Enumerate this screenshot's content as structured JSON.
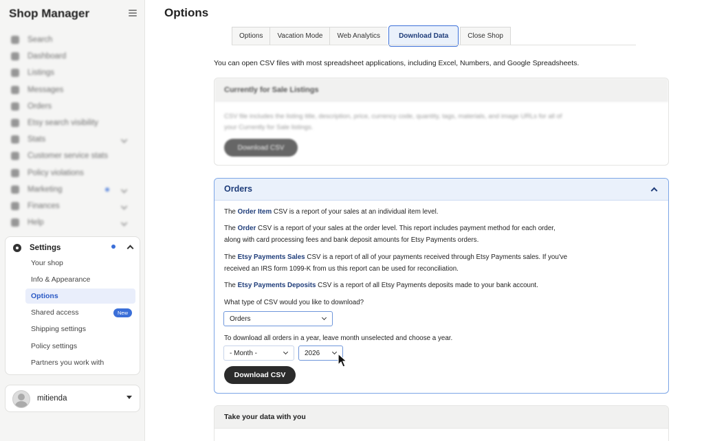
{
  "sidebar": {
    "brand": "Shop Manager",
    "nav": [
      {
        "label": "Search",
        "icon": "search-icon"
      },
      {
        "label": "Dashboard",
        "icon": "home-icon"
      },
      {
        "label": "Listings",
        "icon": "tag-icon"
      },
      {
        "label": "Messages",
        "icon": "chat-icon"
      },
      {
        "label": "Orders",
        "icon": "receipt-icon"
      },
      {
        "label": "Etsy search visibility",
        "icon": "visibility-icon"
      },
      {
        "label": "Stats",
        "icon": "chart-icon",
        "chevron": true
      },
      {
        "label": "Customer service stats",
        "icon": "gauge-icon"
      },
      {
        "label": "Policy violations",
        "icon": "flag-icon"
      },
      {
        "label": "Marketing",
        "icon": "megaphone-icon",
        "chevron": true,
        "dot": true
      },
      {
        "label": "Finances",
        "icon": "bank-icon",
        "chevron": true
      },
      {
        "label": "Help",
        "icon": "help-icon",
        "chevron": true
      }
    ],
    "settings": {
      "label": "Settings",
      "items": [
        {
          "label": "Your shop"
        },
        {
          "label": "Info & Appearance"
        },
        {
          "label": "Options",
          "active": true
        },
        {
          "label": "Shared access",
          "badge": "New"
        },
        {
          "label": "Shipping settings"
        },
        {
          "label": "Policy settings"
        },
        {
          "label": "Partners you work with"
        }
      ]
    },
    "user": {
      "name": "mitienda"
    }
  },
  "main": {
    "title": "Options",
    "tabs": [
      {
        "label": "Options"
      },
      {
        "label": "Vacation Mode"
      },
      {
        "label": "Web Analytics"
      },
      {
        "label": "Download Data",
        "active": true
      },
      {
        "label": "Close Shop"
      }
    ],
    "intro": "You can open CSV files with most spreadsheet applications, including Excel, Numbers, and Google Spreadsheets.",
    "listings_card": {
      "title": "Currently for Sale Listings",
      "text": "CSV file includes the listing title, description, price, currency code, quantity, tags, materials, and image URLs for all of your Currently for Sale listings.",
      "button": "Download CSV"
    },
    "orders_card": {
      "title": "Orders",
      "p1_bold": "Order Item",
      "p1_rest": " CSV is a report of your sales at an individual item level.",
      "p2_bold": "Order",
      "p2_rest": " CSV is a report of your sales at the order level. This report includes payment method for each order, along with card processing fees and bank deposit amounts for Etsy Payments orders.",
      "p3_bold": "Etsy Payments Sales",
      "p3_rest": " CSV is a report of all of your payments received through Etsy Payments sales. If you've received an IRS form 1099-K from us this report can be used for reconciliation.",
      "p4_bold": "Etsy Payments Deposits",
      "p4_rest": " CSV is a report of all Etsy Payments deposits made to your bank account.",
      "the": "The ",
      "question": "What type of CSV would you like to download?",
      "type_value": "Orders",
      "year_hint": "To download all orders in a year, leave month unselected and choose a year.",
      "month_value": "- Month -",
      "year_value": "2026",
      "button": "Download CSV"
    },
    "take_card": {
      "title": "Take your data with you"
    }
  },
  "colors": {
    "accent": "#3b6fd8",
    "accent_dark": "#1f3d7a",
    "button_dark": "#2b2b2b"
  }
}
